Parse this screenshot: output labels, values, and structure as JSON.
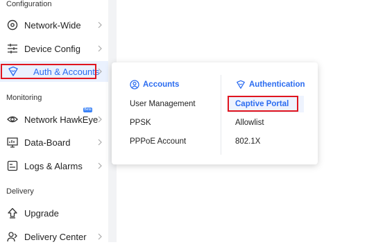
{
  "sidebar": {
    "sections": {
      "configuration": "Configuration",
      "monitoring": "Monitoring",
      "delivery": "Delivery"
    },
    "items": [
      {
        "label": "Network-Wide",
        "icon": "network-icon"
      },
      {
        "label": "Device Config",
        "icon": "sliders-icon"
      },
      {
        "label": "Auth & Accounts",
        "icon": "shield-heart-icon"
      },
      {
        "label": "Network HawkEye",
        "icon": "eye-icon"
      },
      {
        "label": "Data-Board",
        "icon": "monitor-chart-icon"
      },
      {
        "label": "Logs & Alarms",
        "icon": "log-icon"
      },
      {
        "label": "Upgrade",
        "icon": "upgrade-icon"
      },
      {
        "label": "Delivery Center",
        "icon": "delivery-icon"
      }
    ],
    "beta_badge": "Beta"
  },
  "popover": {
    "accounts": {
      "title": "Accounts",
      "items": [
        "User Management",
        "PPSK",
        "PPPoE Account"
      ]
    },
    "authentication": {
      "title": "Authentication",
      "items": [
        "Captive Portal",
        "Allowlist",
        "802.1X"
      ]
    }
  },
  "colors": {
    "accent": "#2b6cf0",
    "highlight": "#e0141e",
    "active_bg": "#eaf1fe"
  }
}
